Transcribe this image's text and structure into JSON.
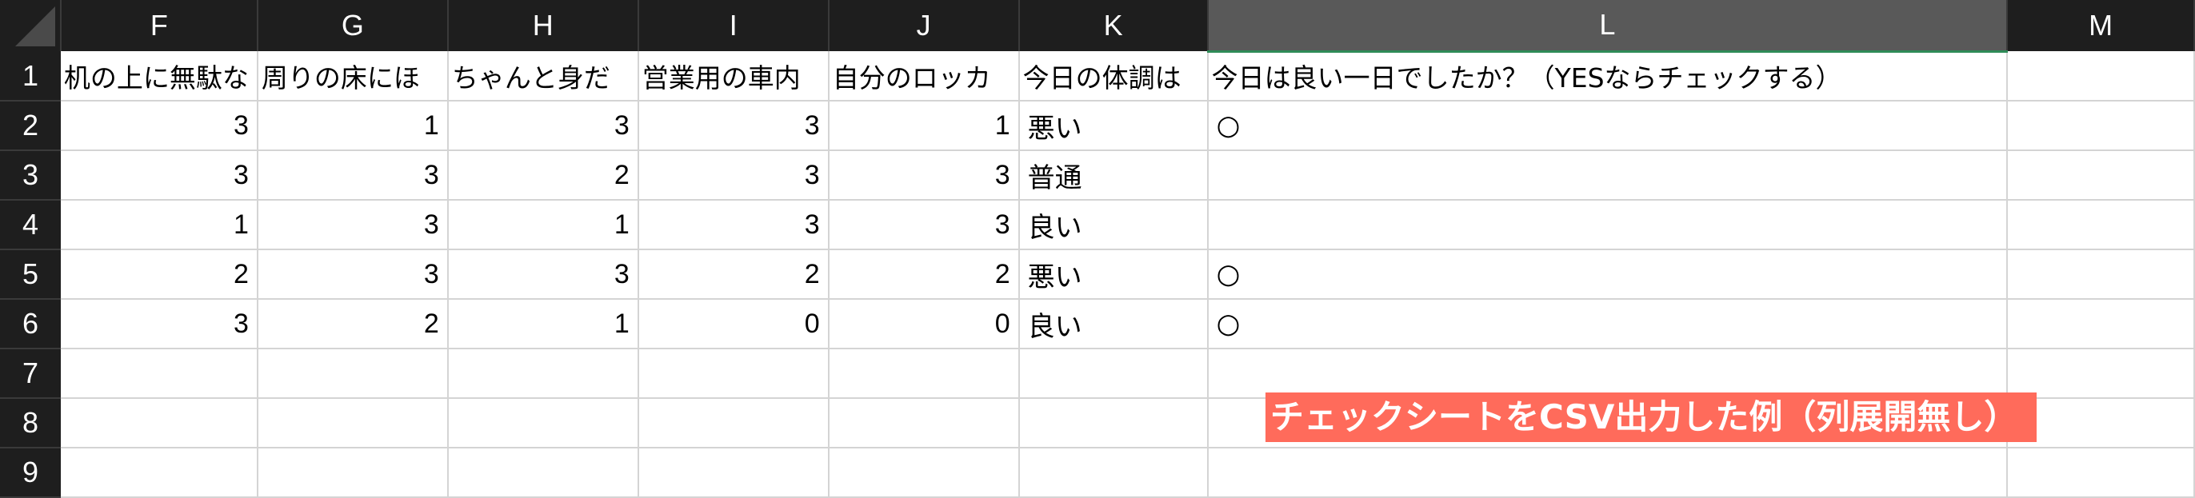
{
  "columns": [
    "F",
    "G",
    "H",
    "I",
    "J",
    "K",
    "L",
    "M"
  ],
  "selected_column": "L",
  "row_numbers": [
    "1",
    "2",
    "3",
    "4",
    "5",
    "6",
    "7",
    "8",
    "9"
  ],
  "header_row": {
    "F": "机の上に無駄な",
    "G": "周りの床にほ",
    "H": "ちゃんと身だ",
    "I": "営業用の車内",
    "J": "自分のロッカ",
    "K": "今日の体調は",
    "L": "今日は良い一日でしたか？（YESならチェックする）",
    "M": ""
  },
  "data_rows": [
    {
      "F": "3",
      "G": "1",
      "H": "3",
      "I": "3",
      "J": "1",
      "K": "悪い",
      "L": "○"
    },
    {
      "F": "3",
      "G": "3",
      "H": "2",
      "I": "3",
      "J": "3",
      "K": "普通",
      "L": ""
    },
    {
      "F": "1",
      "G": "3",
      "H": "1",
      "I": "3",
      "J": "3",
      "K": "良い",
      "L": ""
    },
    {
      "F": "2",
      "G": "3",
      "H": "3",
      "I": "2",
      "J": "2",
      "K": "悪い",
      "L": "○"
    },
    {
      "F": "3",
      "G": "2",
      "H": "1",
      "I": "0",
      "J": "0",
      "K": "良い",
      "L": "○"
    }
  ],
  "annotation": {
    "text": "チェックシートをCSV出力した例（列展開無し）",
    "color": "#ff6b5b"
  },
  "colors": {
    "header_bg": "#1e1e1e",
    "selected_header_bg": "#595959",
    "grid": "#d4d4d4"
  }
}
